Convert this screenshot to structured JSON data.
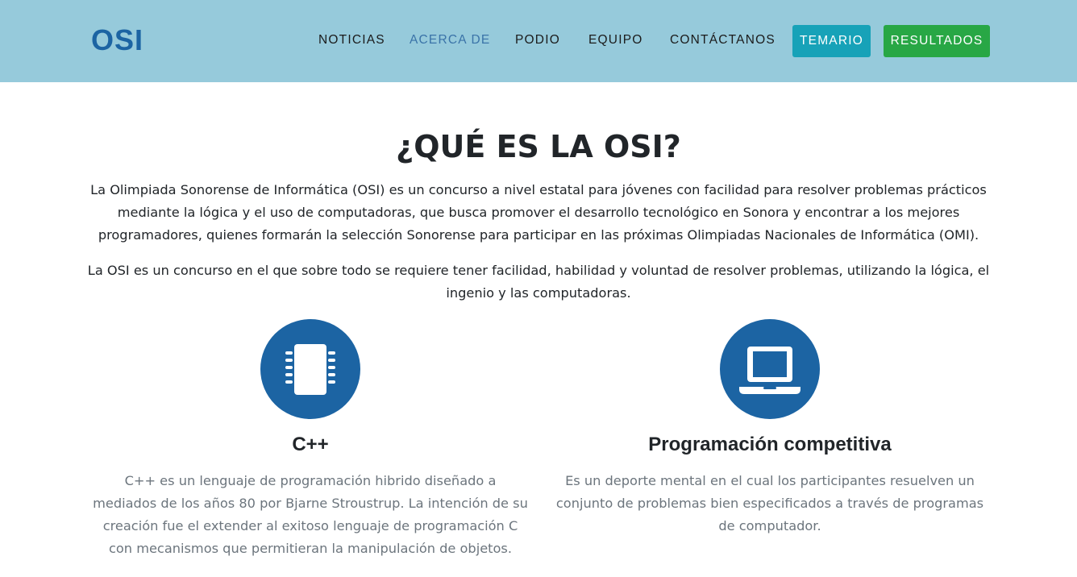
{
  "nav": {
    "brand": "OSI",
    "links": [
      {
        "label": "NOTICIAS"
      },
      {
        "label": "ACERCA DE"
      },
      {
        "label": "PODIO"
      },
      {
        "label": "EQUIPO"
      },
      {
        "label": "CONTÁCTANOS"
      }
    ],
    "temario_label": "TEMARIO",
    "resultados_label": "RESULTADOS"
  },
  "about": {
    "title": "¿QUÉ ES LA OSI?",
    "paragraph_1": "La Olimpiada Sonorense de Informática (OSI) es un concurso a nivel estatal para jóvenes con facilidad para resolver problemas prácticos mediante la lógica y el uso de computadoras, que busca promover el desarrollo tecnológico en Sonora y encontrar a los mejores programadores, quienes formarán la selección Sonorense para participar en las próximas Olimpiadas Nacionales de Informática (OMI).",
    "paragraph_2": "La OSI es un concurso en el que sobre todo se requiere tener facilidad, habilidad y voluntad de resolver problemas, utilizando la lógica, el ingenio y las computadoras."
  },
  "features": [
    {
      "icon": "microchip-icon",
      "title": "C++",
      "text": "C++ es un lenguaje de programación hibrido diseñado a mediados de los años 80 por Bjarne Stroustrup. La intención de su creación fue el extender al exitoso lenguaje de programación C con mecanismos que permitieran la manipulación de objetos."
    },
    {
      "icon": "laptop-icon",
      "title": "Programación competitiva",
      "text": "Es un deporte mental en el cual los participantes resuelven un conjunto de problemas bien especificados a través de programas de computador."
    }
  ],
  "colors": {
    "navbar_bg": "#96cadb",
    "brand": "#1c64a3",
    "active_link": "#3a73a8",
    "temario_btn": "#17a2b8",
    "resultados_btn": "#28a745",
    "icon_circle": "#1c64a3",
    "muted_text": "#6c757d"
  }
}
